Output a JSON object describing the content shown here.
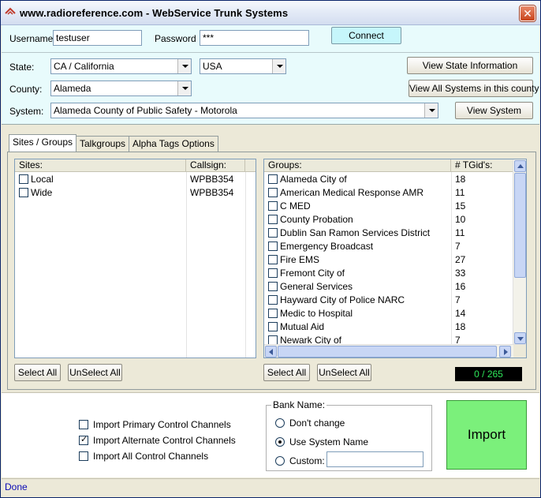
{
  "window": {
    "title": "www.radioreference.com - WebService Trunk Systems",
    "close": "✕"
  },
  "login": {
    "username_label": "Username:",
    "username_value": "testuser",
    "password_label": "Password",
    "password_value": "***",
    "connect": "Connect"
  },
  "filters": {
    "state_label": "State:",
    "state_value": "CA / California",
    "country_value": "USA",
    "county_label": "County:",
    "county_value": "Alameda",
    "system_label": "System:",
    "system_value": "Alameda  County of  Public Safety  - Motorola",
    "view_state": "View State Information",
    "view_all": "View All Systems in this county",
    "view_system": "View System"
  },
  "tabs": [
    "Sites / Groups",
    "Talkgroups",
    "Alpha Tags Options"
  ],
  "sites": {
    "headers": [
      "Sites:",
      "Callsign:"
    ],
    "rows": [
      {
        "name": "Local",
        "callsign": "WPBB354"
      },
      {
        "name": "Wide",
        "callsign": "WPBB354"
      }
    ],
    "select_all": "Select All",
    "unselect_all": "UnSelect All"
  },
  "groups": {
    "headers": [
      "Groups:",
      "# TGid's:"
    ],
    "rows": [
      {
        "name": "Alameda  City of",
        "count": "18"
      },
      {
        "name": "American Medical Response  AMR",
        "count": "11"
      },
      {
        "name": "C MED",
        "count": "15"
      },
      {
        "name": "County Probation",
        "count": "10"
      },
      {
        "name": "Dublin San Ramon Services District",
        "count": "11"
      },
      {
        "name": "Emergency Broadcast",
        "count": "7"
      },
      {
        "name": "Fire EMS",
        "count": "27"
      },
      {
        "name": "Fremont  City of",
        "count": "33"
      },
      {
        "name": "General Services",
        "count": "16"
      },
      {
        "name": "Hayward  City of Police  NARC",
        "count": "7"
      },
      {
        "name": "Medic to Hospital",
        "count": "14"
      },
      {
        "name": "Mutual Aid",
        "count": "18"
      },
      {
        "name": "Newark  City of",
        "count": "7"
      }
    ],
    "select_all": "Select All",
    "unselect_all": "UnSelect All",
    "counter": "0 / 265"
  },
  "options": {
    "primary": "Import Primary Control Channels",
    "alternate": "Import Alternate Control Channels",
    "all": "Import All Control Channels"
  },
  "bank": {
    "legend": "Bank Name:",
    "dont_change": "Don't change",
    "use_system": "Use System Name",
    "custom": "Custom:",
    "custom_value": ""
  },
  "import_label": "Import",
  "status": "Done",
  "colors": {
    "counter_text": "#2ee85a",
    "import_bg": "#7bf07b",
    "top_panel": "#e8fbfc"
  }
}
